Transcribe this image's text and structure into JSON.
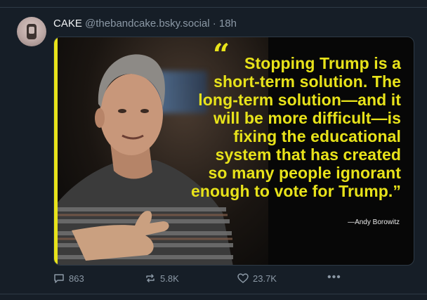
{
  "post": {
    "display_name": "CAKE",
    "handle": "@thebandcake.bsky.social",
    "separator": "·",
    "time": "18h",
    "image": {
      "quote_mark": "“",
      "quote_lines": [
        "Stopping Trump is a",
        "short-term solution. The",
        "long-term solution—and it",
        "will be more difficult—is",
        "fixing the educational",
        "system that has created",
        "so many people ignorant",
        "enough to vote for Trump.”"
      ],
      "attribution": "—Andy Borowitz",
      "accent_color": "#e8e31a"
    },
    "actions": {
      "replies": "863",
      "reposts": "5.8K",
      "likes": "23.7K",
      "more": "•••"
    }
  },
  "icons": {
    "reply": "speech-bubble-icon",
    "repost": "repost-arrows-icon",
    "like": "heart-icon",
    "more": "ellipsis-icon"
  }
}
